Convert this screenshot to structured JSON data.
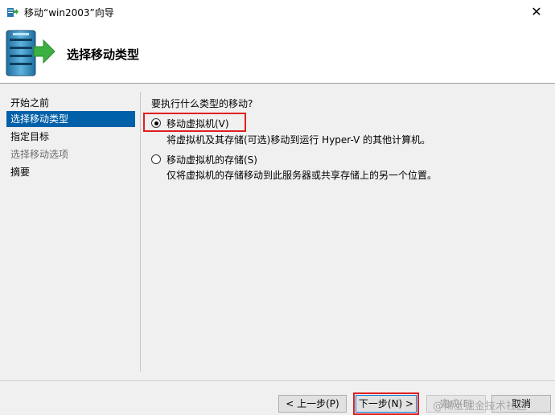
{
  "window": {
    "title": "移动“win2003”向导",
    "close_glyph": "✕"
  },
  "banner": {
    "title": "选择移动类型"
  },
  "nav": {
    "items": [
      {
        "label": "开始之前",
        "state": "normal"
      },
      {
        "label": "选择移动类型",
        "state": "selected"
      },
      {
        "label": "指定目标",
        "state": "normal"
      },
      {
        "label": "选择移动选项",
        "state": "disabled"
      },
      {
        "label": "摘要",
        "state": "normal"
      }
    ]
  },
  "main": {
    "question": "要执行什么类型的移动?",
    "options": [
      {
        "label": "移动虚拟机(V)",
        "checked": true,
        "description": "将虚拟机及其存储(可选)移动到运行 Hyper-V 的其他计算机。"
      },
      {
        "label": "移动虚拟机的存储(S)",
        "checked": false,
        "description": "仅将虚拟机的存储移动到此服务器或共享存储上的另一个位置。"
      }
    ]
  },
  "buttons": {
    "prev": "< 上一步(P)",
    "next": "下一步(N) >",
    "finish": "完成(F)",
    "cancel": "取消"
  },
  "watermark": "@稀土掘金技术社区",
  "colors": {
    "selection": "#0060a8",
    "highlight": "#e02020",
    "banner_bg": "#ffffff"
  }
}
